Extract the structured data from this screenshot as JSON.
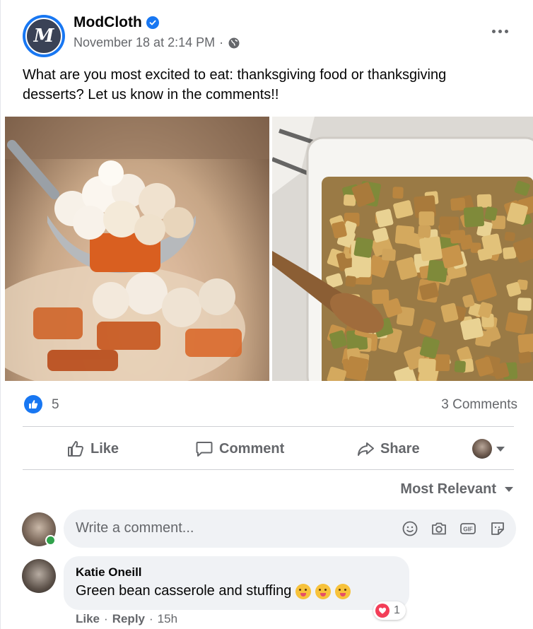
{
  "post": {
    "page_name": "ModCloth",
    "avatar_letter": "M",
    "date": "November 18 at 2:14 PM",
    "separator": "·",
    "text": "What are you most excited to eat: thanksgiving food or thanksgiving desserts? Let us know in the comments!!",
    "photos": [
      {
        "icon": "sweet-potato-casserole-photo"
      },
      {
        "icon": "stuffing-dish-photo"
      }
    ]
  },
  "stats": {
    "likes": "5",
    "comments": "3 Comments"
  },
  "actions": {
    "like": "Like",
    "comment": "Comment",
    "share": "Share"
  },
  "sort": {
    "label": "Most Relevant"
  },
  "composer": {
    "placeholder": "Write a comment..."
  },
  "comment": {
    "author": "Katie Oneill",
    "text": "Green bean casserole and stuffing",
    "reaction_count": "1",
    "like": "Like",
    "reply": "Reply",
    "time": "15h",
    "dot": "·"
  },
  "colors": {
    "brand_blue": "#1877f2",
    "secondary_text": "#65676b",
    "heart_red": "#f33e58",
    "online_green": "#31a24c"
  }
}
